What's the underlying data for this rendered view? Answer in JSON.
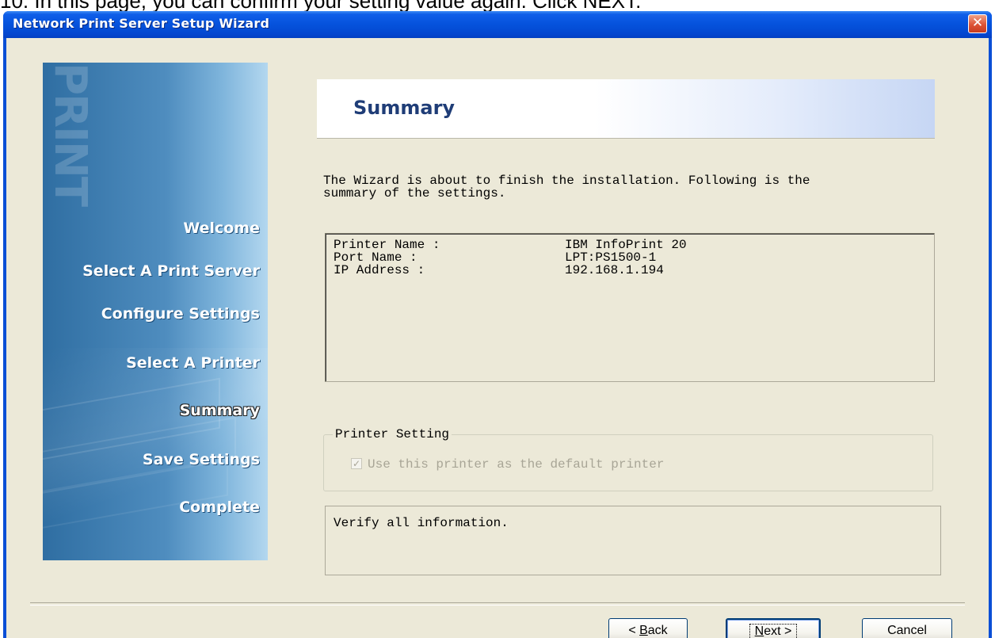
{
  "caption": "10. In this page, you can confirm your setting value again. Click NEXT.",
  "window": {
    "title": "Network Print Server Setup Wizard",
    "close_label": "✕"
  },
  "sidebar": {
    "watermark": "PRINT",
    "steps": [
      {
        "label": "Welcome"
      },
      {
        "label": "Select A Print Server"
      },
      {
        "label": "Configure Settings"
      },
      {
        "label": "Select  A  Printer"
      },
      {
        "label": "Summary"
      },
      {
        "label": "Save Settings"
      },
      {
        "label": "Complete"
      }
    ],
    "active_step": "Summary"
  },
  "header": {
    "title": "Summary"
  },
  "intro": {
    "line1": "The Wizard is about to finish the installation. Following is the",
    "line2": "summary of the settings."
  },
  "summary": {
    "rows": [
      {
        "key": "Printer Name :",
        "value": "IBM InfoPrint 20"
      },
      {
        "key": "Port Name :",
        "value": "LPT:PS1500-1"
      },
      {
        "key": "IP Address :",
        "value": "192.168.1.194"
      }
    ]
  },
  "printer_setting": {
    "legend": "Printer Setting",
    "default_checkbox_label": "Use this printer as the default printer",
    "checked": true,
    "enabled": false
  },
  "message": {
    "text": "Verify all information."
  },
  "buttons": {
    "back_prefix": "< ",
    "back_mnemonic": "B",
    "back_rest": "ack",
    "next_mnemonic": "N",
    "next_rest": "ext >",
    "cancel": "Cancel"
  }
}
